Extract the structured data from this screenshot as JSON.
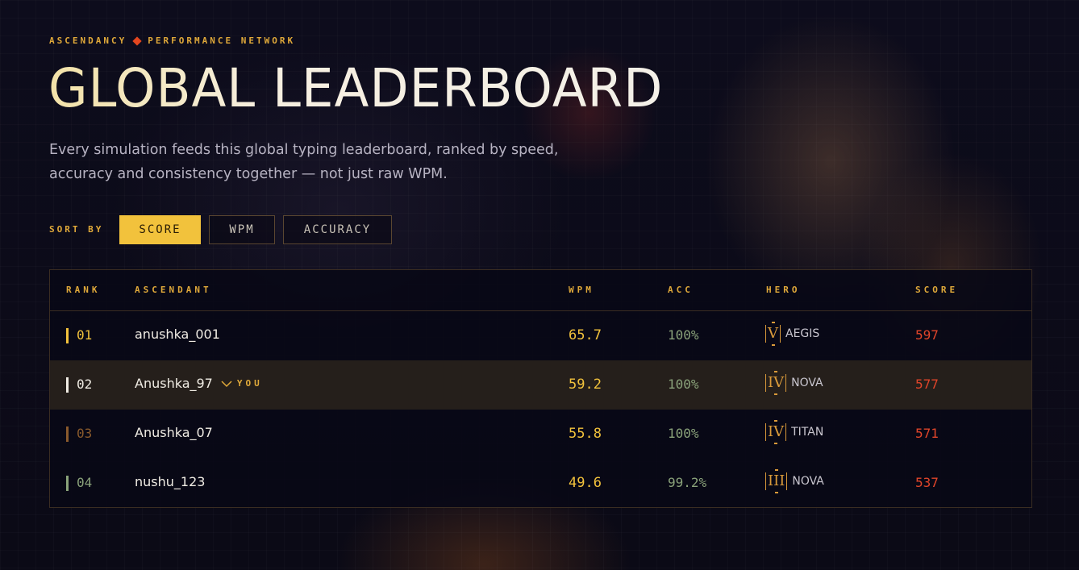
{
  "header": {
    "eyebrow_left": "ASCENDANCY",
    "eyebrow_right": "PERFORMANCE NETWORK",
    "title": "GLOBAL LEADERBOARD",
    "subtitle_line1": "Every simulation feeds this global typing leaderboard, ranked by speed,",
    "subtitle_line2": "accuracy and consistency together — not just raw WPM."
  },
  "sort": {
    "label": "SORT BY",
    "options": [
      "SCORE",
      "WPM",
      "ACCURACY"
    ],
    "active": "SCORE"
  },
  "table": {
    "columns": {
      "rank": "RANK",
      "ascendant": "ASCENDANT",
      "wpm": "WPM",
      "acc": "ACC",
      "hero": "HERO",
      "score": "SCORE"
    },
    "you_label": "YOU",
    "rows": [
      {
        "rank": "01",
        "name": "anushka_001",
        "wpm": "65.7",
        "acc": "100%",
        "tier": "V",
        "hero": "AEGIS",
        "score": "597",
        "rank_color": "#f2c23c",
        "bar_color": "#f2c23c",
        "is_you": false
      },
      {
        "rank": "02",
        "name": "Anushka_97",
        "wpm": "59.2",
        "acc": "100%",
        "tier": "IV",
        "hero": "NOVA",
        "score": "577",
        "rank_color": "#f0ece4",
        "bar_color": "#f0ece4",
        "is_you": true
      },
      {
        "rank": "03",
        "name": "Anushka_07",
        "wpm": "55.8",
        "acc": "100%",
        "tier": "IV",
        "hero": "TITAN",
        "score": "571",
        "rank_color": "#8a5a2c",
        "bar_color": "#8a5a2c",
        "is_you": false
      },
      {
        "rank": "04",
        "name": "nushu_123",
        "wpm": "49.6",
        "acc": "99.2%",
        "tier": "III",
        "hero": "NOVA",
        "score": "537",
        "rank_color": "#8aa27a",
        "bar_color": "#8aa27a",
        "is_you": false
      }
    ]
  },
  "colors": {
    "accent": "#f2c23c",
    "label_gold": "#e0a93a",
    "score_red": "#e0452a",
    "acc_green": "#8aa27a",
    "diamond": "#e3461f"
  }
}
